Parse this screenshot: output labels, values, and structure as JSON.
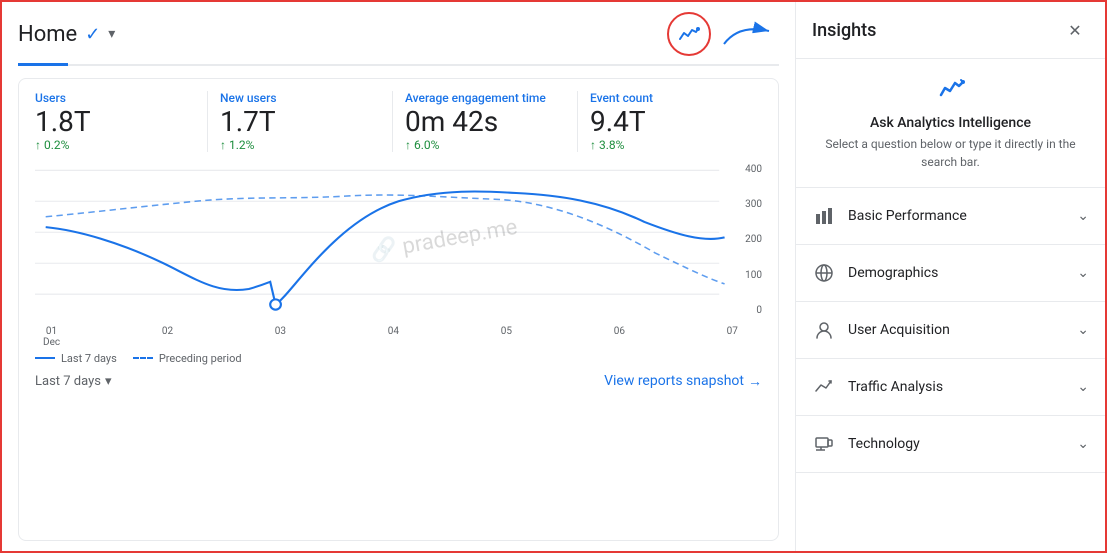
{
  "header": {
    "home_title": "Home",
    "check_icon": "✓",
    "dropdown_icon": "▾"
  },
  "stats": [
    {
      "label": "Users",
      "value": "1.8T",
      "change": "↑ 0.2%",
      "positive": true
    },
    {
      "label": "New users",
      "value": "1.7T",
      "change": "↑ 1.2%",
      "positive": true
    },
    {
      "label": "Average engagement time",
      "value": "0m 42s",
      "change": "↑ 6.0%",
      "positive": true
    },
    {
      "label": "Event count",
      "value": "9.4T",
      "change": "↑ 3.8%",
      "positive": true
    }
  ],
  "chart": {
    "x_labels": [
      "01\nDec",
      "02",
      "03",
      "04",
      "05",
      "06",
      "07"
    ],
    "y_labels": [
      "400",
      "300",
      "200",
      "100",
      "0"
    ]
  },
  "legend": {
    "solid_label": "Last 7 days",
    "dashed_label": "Preceding period"
  },
  "footer": {
    "date_range": "Last 7 days",
    "view_reports": "View reports snapshot",
    "arrow": "→"
  },
  "watermark": "🔗 pradeep.me",
  "insights": {
    "title": "Insights",
    "close_label": "✕",
    "ask_title": "Ask Analytics Intelligence",
    "ask_subtitle": "Select a question below or type it directly in the search bar.",
    "items": [
      {
        "icon": "chart",
        "label": "Basic Performance",
        "chevron": "⌄"
      },
      {
        "icon": "globe",
        "label": "Demographics",
        "chevron": "⌄"
      },
      {
        "icon": "person",
        "label": "User Acquisition",
        "chevron": "⌄"
      },
      {
        "icon": "trending",
        "label": "Traffic Analysis",
        "chevron": "⌄"
      },
      {
        "icon": "device",
        "label": "Technology",
        "chevron": "⌄"
      }
    ]
  }
}
